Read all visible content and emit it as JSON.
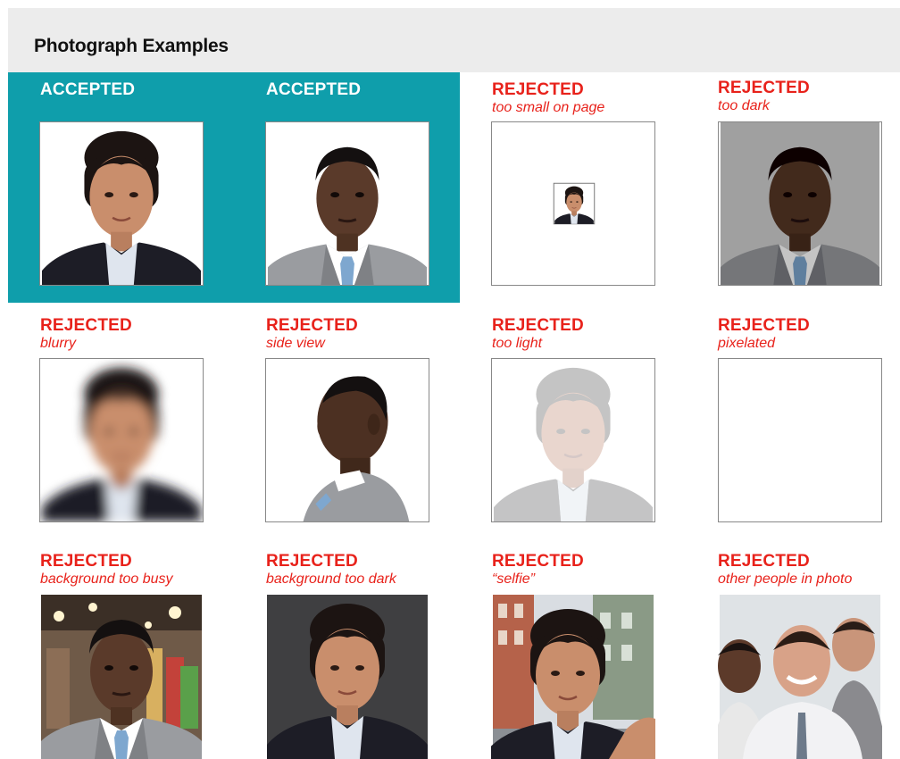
{
  "header": {
    "title": "Photograph Examples"
  },
  "colors": {
    "accepted_band": "#0f9eab",
    "rejected_text": "#e8221b",
    "header_bg": "#ececec"
  },
  "examples": [
    {
      "status": "ACCEPTED",
      "reason": "",
      "subject": "woman-portrait-icon"
    },
    {
      "status": "ACCEPTED",
      "reason": "",
      "subject": "man-portrait-icon"
    },
    {
      "status": "REJECTED",
      "reason": "too small on page",
      "subject": "woman-portrait-icon"
    },
    {
      "status": "REJECTED",
      "reason": "too dark",
      "subject": "man-portrait-icon"
    },
    {
      "status": "REJECTED",
      "reason": "blurry",
      "subject": "woman-portrait-icon"
    },
    {
      "status": "REJECTED",
      "reason": "side view",
      "subject": "man-portrait-icon"
    },
    {
      "status": "REJECTED",
      "reason": "too light",
      "subject": "woman-portrait-icon"
    },
    {
      "status": "REJECTED",
      "reason": "pixelated",
      "subject": "man-portrait-icon"
    },
    {
      "status": "REJECTED",
      "reason": "background too busy",
      "subject": "man-portrait-icon"
    },
    {
      "status": "REJECTED",
      "reason": "background too dark",
      "subject": "woman-portrait-icon"
    },
    {
      "status": "REJECTED",
      "reason": "“selfie”",
      "subject": "woman-portrait-icon"
    },
    {
      "status": "REJECTED",
      "reason": "other people in photo",
      "subject": "group-portrait-icon"
    }
  ]
}
